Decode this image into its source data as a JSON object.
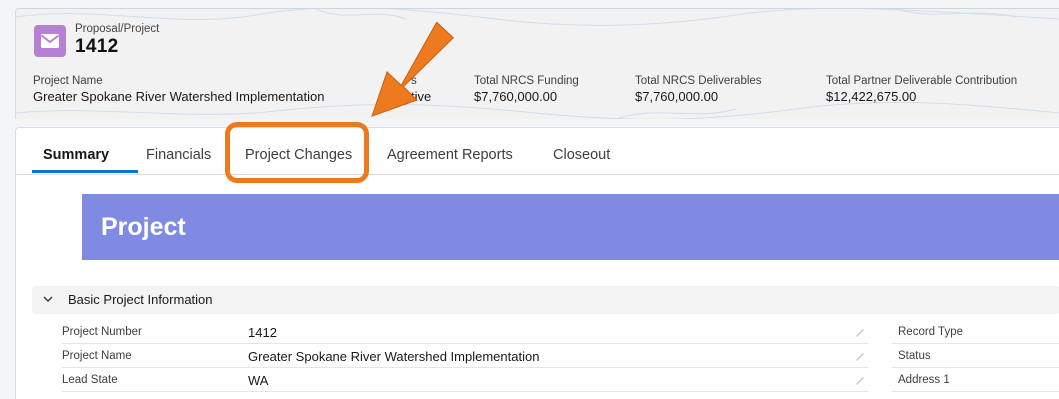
{
  "header": {
    "object_type": "Proposal/Project",
    "record_title": "1412",
    "icon": "envelope-icon",
    "icon_color": "#b781d3",
    "fields": [
      {
        "label": "Project Name",
        "value": "Greater Spokane River Watershed Implementation"
      },
      {
        "label": "s",
        "value": "tive"
      },
      {
        "label": "Total NRCS Funding",
        "value": "$7,760,000.00"
      },
      {
        "label": "Total NRCS Deliverables",
        "value": "$7,760,000.00"
      },
      {
        "label": "Total Partner Deliverable Contribution",
        "value": "$12,422,675.00"
      }
    ]
  },
  "tabs": [
    {
      "label": "Summary",
      "active": true
    },
    {
      "label": "Financials"
    },
    {
      "label": "Project Changes"
    },
    {
      "label": "Agreement Reports"
    },
    {
      "label": "Closeout"
    }
  ],
  "banner": {
    "title": "Project",
    "color": "#7f8be3"
  },
  "section": {
    "title": "Basic Project Information",
    "rows": [
      {
        "label": "Project Number",
        "value": "1412",
        "right_label": "Record Type"
      },
      {
        "label": "Project Name",
        "value": "Greater Spokane River Watershed Implementation",
        "right_label": "Status"
      },
      {
        "label": "Lead State",
        "value": "WA",
        "right_label": "Address 1"
      }
    ]
  },
  "annotation": {
    "color": "#ee7a1f",
    "target": "Project Changes"
  }
}
